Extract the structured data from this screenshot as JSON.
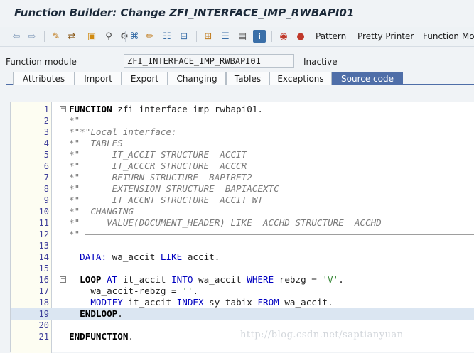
{
  "window": {
    "title": "Function Builder: Change ZFI_INTERFACE_IMP_RWBAPI01"
  },
  "toolbar": {
    "buttons": [
      {
        "name": "back-icon",
        "glyph": "⇦"
      },
      {
        "name": "forward-icon",
        "glyph": "⇨"
      },
      {
        "name": "display-change-icon",
        "glyph": "✎"
      },
      {
        "name": "active-inactive-icon",
        "glyph": "⇄"
      },
      {
        "name": "other-object-icon",
        "glyph": "▣"
      },
      {
        "name": "check-icon",
        "glyph": "⚲"
      },
      {
        "name": "activate-icon",
        "glyph": "⚙"
      },
      {
        "name": "where-used-icon",
        "glyph": "⌘"
      },
      {
        "name": "object-list-icon",
        "glyph": "☷"
      },
      {
        "name": "navigation-window-icon",
        "glyph": "⊟"
      },
      {
        "name": "hierarchy-icon",
        "glyph": "⊞"
      },
      {
        "name": "info-icon",
        "glyph": "i"
      },
      {
        "name": "debug-icon",
        "glyph": "◉"
      },
      {
        "name": "stop-icon",
        "glyph": "●"
      }
    ],
    "pattern_label": "Pattern",
    "pretty_printer_label": "Pretty Printer",
    "function_module_label": "Function Mod"
  },
  "function_module": {
    "label": "Function module",
    "value": "ZFI_INTERFACE_IMP_RWBAPI01",
    "status": "Inactive"
  },
  "tabs": [
    {
      "label": "Attributes",
      "active": false
    },
    {
      "label": "Import",
      "active": false
    },
    {
      "label": "Export",
      "active": false
    },
    {
      "label": "Changing",
      "active": false
    },
    {
      "label": "Tables",
      "active": false
    },
    {
      "label": "Exceptions",
      "active": false
    },
    {
      "label": "Source code",
      "active": true
    }
  ],
  "editor": {
    "lines": [
      {
        "n": "1",
        "fold": "⊟",
        "parts": [
          {
            "t": "FUNCTION",
            "c": "kwb"
          },
          {
            "t": " zfi_interface_imp_rwbapi01.",
            "c": ""
          }
        ]
      },
      {
        "n": "2",
        "fold": "",
        "parts": [
          {
            "t": "*\"",
            "c": "cm"
          }
        ],
        "dash": true
      },
      {
        "n": "3",
        "fold": "",
        "parts": [
          {
            "t": "*\"*\"Local interface:",
            "c": "cm"
          }
        ]
      },
      {
        "n": "4",
        "fold": "",
        "parts": [
          {
            "t": "*\"  TABLES",
            "c": "cm"
          }
        ]
      },
      {
        "n": "5",
        "fold": "",
        "parts": [
          {
            "t": "*\"      IT_ACCIT STRUCTURE  ACCIT",
            "c": "cm"
          }
        ]
      },
      {
        "n": "6",
        "fold": "",
        "parts": [
          {
            "t": "*\"      IT_ACCCR STRUCTURE  ACCCR",
            "c": "cm"
          }
        ]
      },
      {
        "n": "7",
        "fold": "",
        "parts": [
          {
            "t": "*\"      RETURN STRUCTURE  BAPIRET2",
            "c": "cm"
          }
        ]
      },
      {
        "n": "8",
        "fold": "",
        "parts": [
          {
            "t": "*\"      EXTENSION STRUCTURE  BAPIACEXTC",
            "c": "cm"
          }
        ]
      },
      {
        "n": "9",
        "fold": "",
        "parts": [
          {
            "t": "*\"      IT_ACCWT STRUCTURE  ACCIT_WT",
            "c": "cm"
          }
        ]
      },
      {
        "n": "10",
        "fold": "",
        "parts": [
          {
            "t": "*\"  CHANGING",
            "c": "cm"
          }
        ]
      },
      {
        "n": "11",
        "fold": "",
        "parts": [
          {
            "t": "*\"     VALUE(DOCUMENT_HEADER) LIKE  ACCHD STRUCTURE  ACCHD",
            "c": "cm"
          }
        ]
      },
      {
        "n": "12",
        "fold": "",
        "parts": [
          {
            "t": "*\"",
            "c": "cm"
          }
        ],
        "dash": true
      },
      {
        "n": "13",
        "fold": "",
        "parts": []
      },
      {
        "n": "14",
        "fold": "",
        "parts": [
          {
            "t": "  DATA:",
            "c": "kw"
          },
          {
            "t": " wa_accit ",
            "c": ""
          },
          {
            "t": "LIKE",
            "c": "kw"
          },
          {
            "t": " accit.",
            "c": ""
          }
        ]
      },
      {
        "n": "15",
        "fold": "",
        "parts": []
      },
      {
        "n": "16",
        "fold": "⊟",
        "parts": [
          {
            "t": "  LOOP",
            "c": "kwb"
          },
          {
            "t": " ",
            "c": ""
          },
          {
            "t": "AT",
            "c": "kw"
          },
          {
            "t": " it_accit ",
            "c": ""
          },
          {
            "t": "INTO",
            "c": "kw"
          },
          {
            "t": " wa_accit ",
            "c": ""
          },
          {
            "t": "WHERE",
            "c": "kw"
          },
          {
            "t": " rebzg = ",
            "c": ""
          },
          {
            "t": "'V'",
            "c": "str"
          },
          {
            "t": ".",
            "c": ""
          }
        ]
      },
      {
        "n": "17",
        "fold": "",
        "parts": [
          {
            "t": "    wa_accit-rebzg = ",
            "c": ""
          },
          {
            "t": "''",
            "c": "str"
          },
          {
            "t": ".",
            "c": ""
          }
        ]
      },
      {
        "n": "18",
        "fold": "",
        "parts": [
          {
            "t": "    MODIFY",
            "c": "kw"
          },
          {
            "t": " it_accit ",
            "c": ""
          },
          {
            "t": "INDEX",
            "c": "kw"
          },
          {
            "t": " sy-tabix ",
            "c": ""
          },
          {
            "t": "FROM",
            "c": "kw"
          },
          {
            "t": " wa_accit.",
            "c": ""
          }
        ]
      },
      {
        "n": "19",
        "fold": "",
        "hl": true,
        "parts": [
          {
            "t": "  ENDLOOP",
            "c": "kwb"
          },
          {
            "t": ".",
            "c": ""
          }
        ]
      },
      {
        "n": "20",
        "fold": "",
        "parts": []
      },
      {
        "n": "21",
        "fold": "",
        "parts": [
          {
            "t": "ENDFUNCTION",
            "c": "kwb"
          },
          {
            "t": ".",
            "c": ""
          }
        ]
      }
    ]
  },
  "watermark": "http://blog.csdn.net/saptianyuan"
}
